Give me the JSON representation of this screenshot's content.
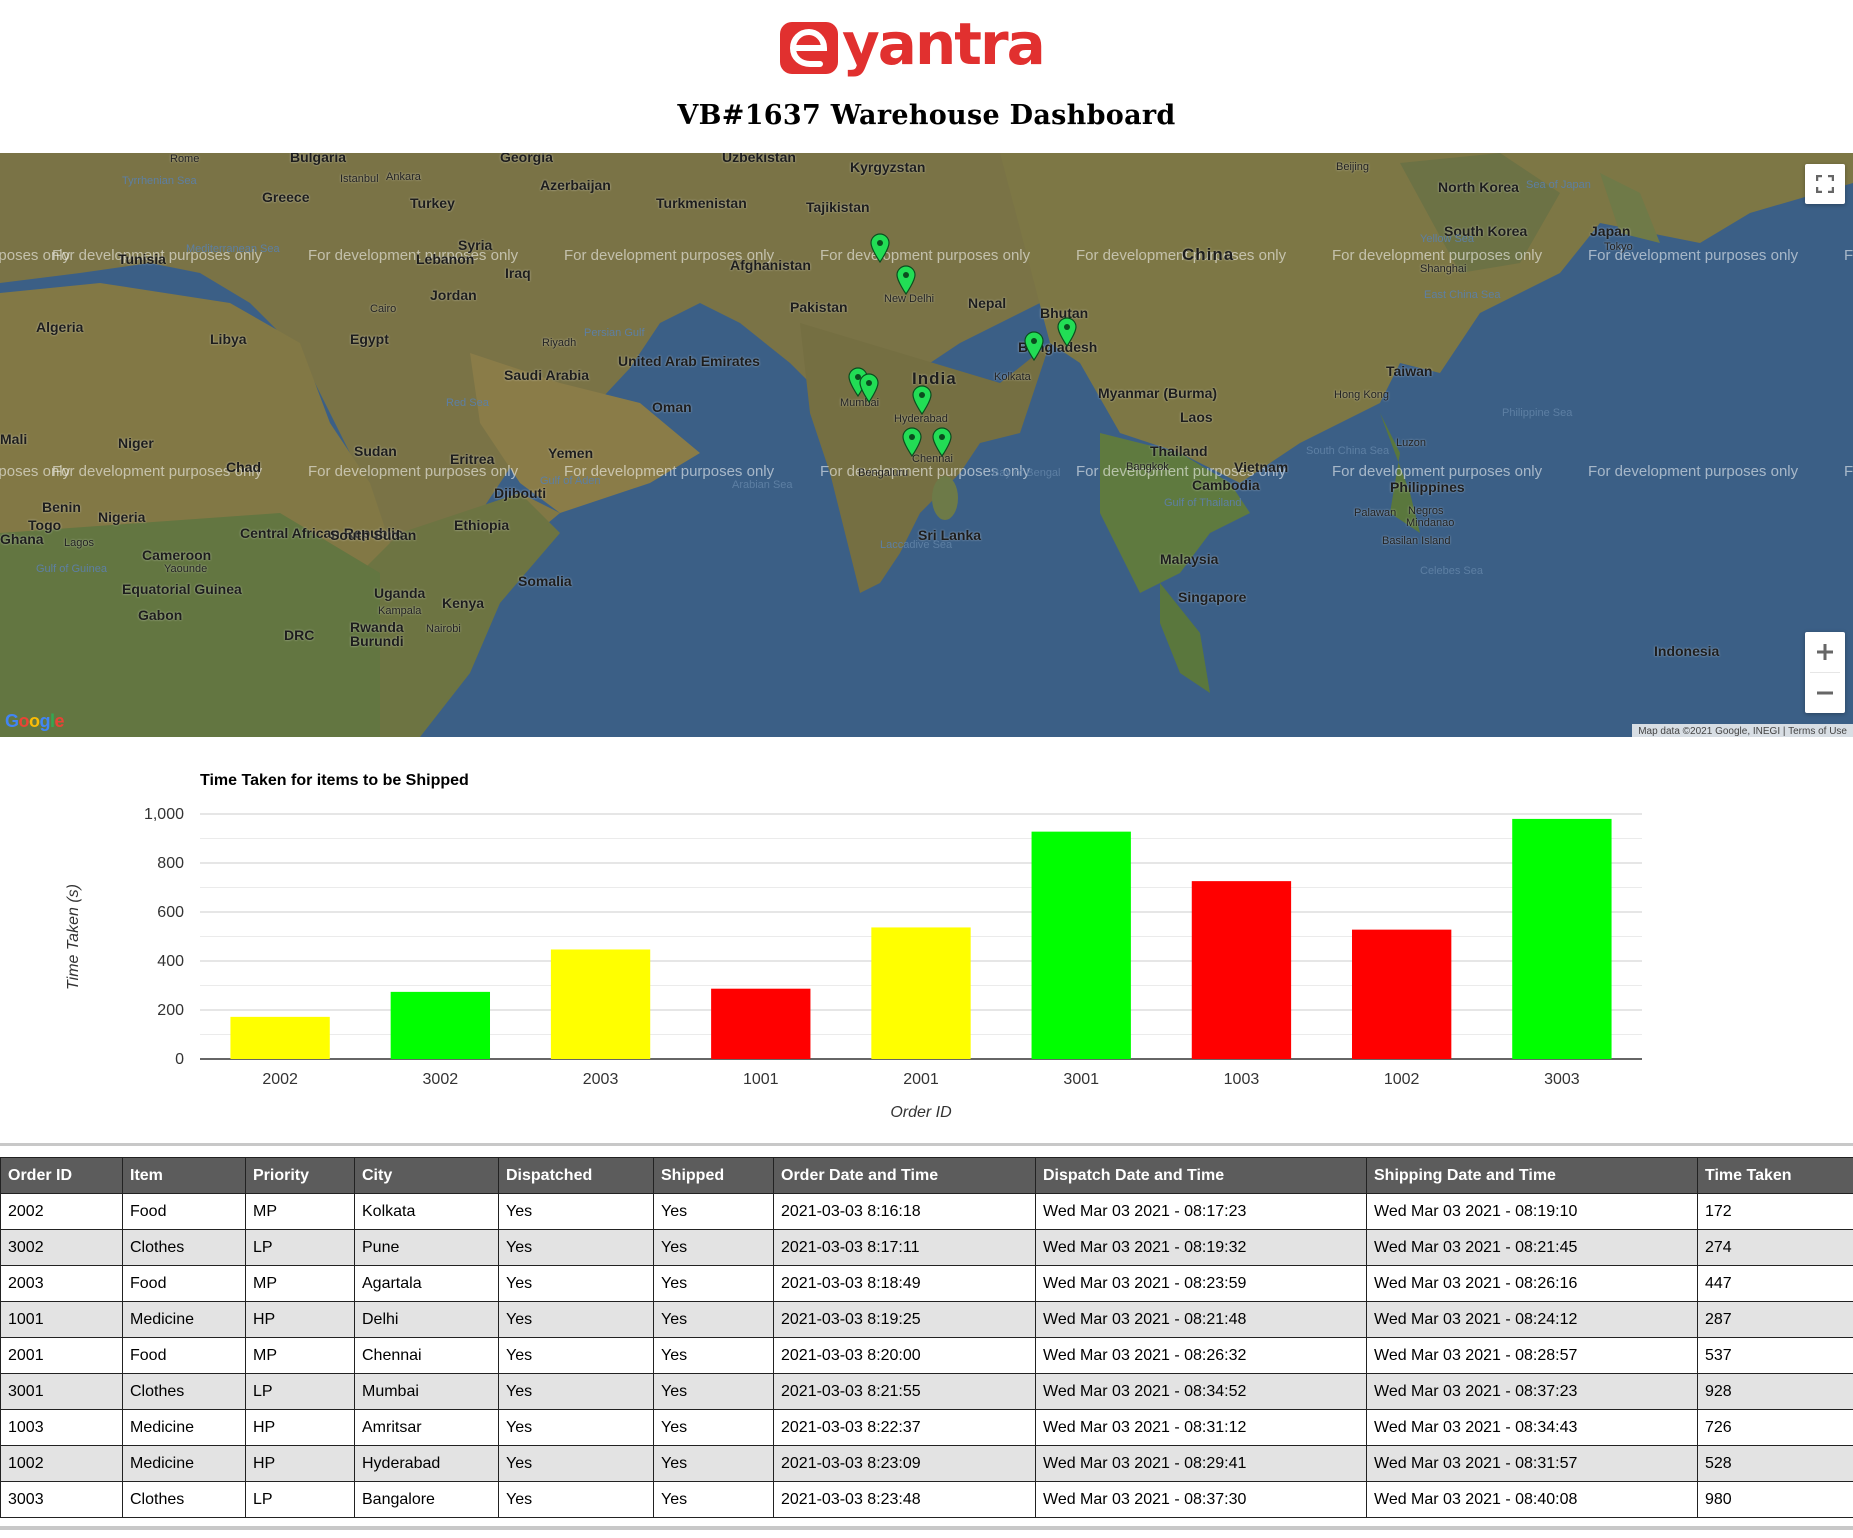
{
  "header": {
    "logo_text": "eyantra",
    "title": "VB#1637 Warehouse Dashboard"
  },
  "map": {
    "watermark": "For development purposes only",
    "attribution": "Map data ©2021 Google, INEGI",
    "terms": "Terms of Use",
    "provider": "Google",
    "labels": {
      "countries": [
        "Bulgaria",
        "Georgia",
        "Uzbekistan",
        "Kyrgyzstan",
        "Greece",
        "Turkey",
        "Azerbaijan",
        "Turkmenistan",
        "Tajikistan",
        "North Korea",
        "South Korea",
        "Japan",
        "China",
        "Tunisia",
        "Syria",
        "Lebanon",
        "Iraq",
        "Afghanistan",
        "Pakistan",
        "Algeria",
        "Libya",
        "Egypt",
        "Jordan",
        "Saudi Arabia",
        "Nepal",
        "Bhutan",
        "Bangladesh",
        "India",
        "Myanmar (Burma)",
        "Taiwan",
        "Mali",
        "Niger",
        "Chad",
        "Sudan",
        "Eritrea",
        "Yemen",
        "Oman",
        "United Arab Emirates",
        "Laos",
        "Thailand",
        "Vietnam",
        "Cambodia",
        "Philippines",
        "Nigeria",
        "Ethiopia",
        "Djibouti",
        "Benin",
        "Togo",
        "Ghana",
        "Central African Republic",
        "South Sudan",
        "Cameroon",
        "Equatorial Guinea",
        "Gabon",
        "Somalia",
        "Uganda",
        "Kenya",
        "Rwanda",
        "Burundi",
        "DRC",
        "Sri Lanka",
        "Malaysia",
        "Singapore",
        "Indonesia"
      ],
      "cities": [
        "Rome",
        "Istanbul",
        "Ankara",
        "Beijing",
        "Tokyo",
        "Shanghai",
        "Cairo",
        "Riyadh",
        "New Delhi",
        "Kolkata",
        "Hyderabad",
        "Bengaluru",
        "Chennai",
        "Mumbai",
        "Hong Kong",
        "Bangkok",
        "Lagos",
        "Yaounde",
        "Kampala",
        "Nairobi",
        "Luzon",
        "Negros",
        "Mindanao",
        "Palawan",
        "Basilan Island"
      ],
      "seas": [
        "Tyrrhenian Sea",
        "Mediterranean Sea",
        "Sea of Japan",
        "Yellow Sea",
        "East China Sea",
        "Persian Gulf",
        "Red Sea",
        "Gulf of Aden",
        "Arabian Sea",
        "Bay of Bengal",
        "Laccadive Sea",
        "South China Sea",
        "Philippine Sea",
        "Gulf of Thailand",
        "Celebes Sea",
        "Gulf of Guinea"
      ]
    },
    "markers": [
      "Amritsar",
      "Delhi",
      "Kolkata",
      "Agartala",
      "Mumbai",
      "Pune",
      "Hyderabad",
      "Bangalore",
      "Chennai"
    ],
    "controls": {
      "fullscreen": "fullscreen-icon",
      "zoom_in": "+",
      "zoom_out": "−"
    }
  },
  "chart_data": {
    "type": "bar",
    "title": "Time Taken for items to be Shipped",
    "xlabel": "Order ID",
    "ylabel": "Time Taken (s)",
    "ylim": [
      0,
      1000
    ],
    "yticks": [
      0,
      200,
      400,
      600,
      800,
      1000
    ],
    "ytick_labels": [
      "0",
      "200",
      "400",
      "600",
      "800",
      "1,000"
    ],
    "grid": true,
    "categories": [
      "2002",
      "3002",
      "2003",
      "1001",
      "2001",
      "3001",
      "1003",
      "1002",
      "3003"
    ],
    "values": [
      172,
      274,
      447,
      287,
      537,
      928,
      726,
      528,
      980
    ],
    "bar_colors": [
      "#ffff00",
      "#00ff00",
      "#ffff00",
      "#ff0000",
      "#ffff00",
      "#00ff00",
      "#ff0000",
      "#ff0000",
      "#00ff00"
    ]
  },
  "table": {
    "headers": [
      "Order ID",
      "Item",
      "Priority",
      "City",
      "Dispatched",
      "Shipped",
      "Order Date and Time",
      "Dispatch Date and Time",
      "Shipping Date and Time",
      "Time Taken"
    ],
    "rows": [
      [
        "2002",
        "Food",
        "MP",
        "Kolkata",
        "Yes",
        "Yes",
        "2021-03-03 8:16:18",
        "Wed Mar 03 2021 - 08:17:23",
        "Wed Mar 03 2021 - 08:19:10",
        "172"
      ],
      [
        "3002",
        "Clothes",
        "LP",
        "Pune",
        "Yes",
        "Yes",
        "2021-03-03 8:17:11",
        "Wed Mar 03 2021 - 08:19:32",
        "Wed Mar 03 2021 - 08:21:45",
        "274"
      ],
      [
        "2003",
        "Food",
        "MP",
        "Agartala",
        "Yes",
        "Yes",
        "2021-03-03 8:18:49",
        "Wed Mar 03 2021 - 08:23:59",
        "Wed Mar 03 2021 - 08:26:16",
        "447"
      ],
      [
        "1001",
        "Medicine",
        "HP",
        "Delhi",
        "Yes",
        "Yes",
        "2021-03-03 8:19:25",
        "Wed Mar 03 2021 - 08:21:48",
        "Wed Mar 03 2021 - 08:24:12",
        "287"
      ],
      [
        "2001",
        "Food",
        "MP",
        "Chennai",
        "Yes",
        "Yes",
        "2021-03-03 8:20:00",
        "Wed Mar 03 2021 - 08:26:32",
        "Wed Mar 03 2021 - 08:28:57",
        "537"
      ],
      [
        "3001",
        "Clothes",
        "LP",
        "Mumbai",
        "Yes",
        "Yes",
        "2021-03-03 8:21:55",
        "Wed Mar 03 2021 - 08:34:52",
        "Wed Mar 03 2021 - 08:37:23",
        "928"
      ],
      [
        "1003",
        "Medicine",
        "HP",
        "Amritsar",
        "Yes",
        "Yes",
        "2021-03-03 8:22:37",
        "Wed Mar 03 2021 - 08:31:12",
        "Wed Mar 03 2021 - 08:34:43",
        "726"
      ],
      [
        "1002",
        "Medicine",
        "HP",
        "Hyderabad",
        "Yes",
        "Yes",
        "2021-03-03 8:23:09",
        "Wed Mar 03 2021 - 08:29:41",
        "Wed Mar 03 2021 - 08:31:57",
        "528"
      ],
      [
        "3003",
        "Clothes",
        "LP",
        "Bangalore",
        "Yes",
        "Yes",
        "2021-03-03 8:23:48",
        "Wed Mar 03 2021 - 08:37:30",
        "Wed Mar 03 2021 - 08:40:08",
        "980"
      ]
    ]
  },
  "colors": {
    "brand_red": "#e1302f",
    "header_bg": "#5c5c5c",
    "marker_green": "#22dd55",
    "ocean": "#3b5f86",
    "land": "#7a7346"
  }
}
